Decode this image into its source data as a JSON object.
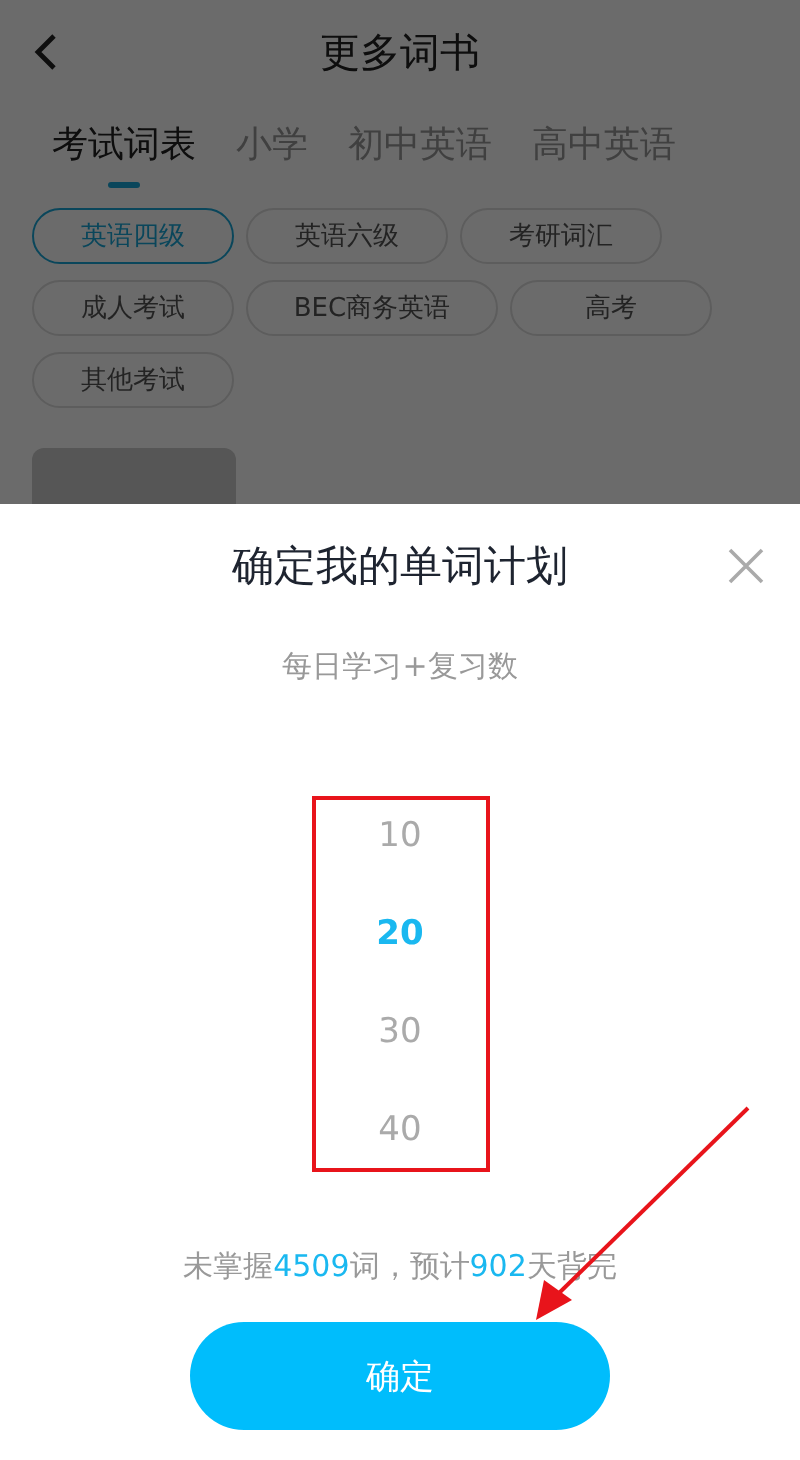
{
  "header": {
    "title": "更多词书"
  },
  "tabs": [
    {
      "label": "考试词表",
      "selected": true
    },
    {
      "label": "小学",
      "selected": false
    },
    {
      "label": "初中英语",
      "selected": false
    },
    {
      "label": "高中英语",
      "selected": false
    }
  ],
  "chips": [
    {
      "label": "英语四级",
      "selected": true
    },
    {
      "label": "英语六级",
      "selected": false
    },
    {
      "label": "考研词汇",
      "selected": false
    },
    {
      "label": "成人考试",
      "selected": false
    },
    {
      "label": "BEC商务英语",
      "selected": false
    },
    {
      "label": "高考",
      "selected": false
    },
    {
      "label": "其他考试",
      "selected": false
    }
  ],
  "dialog": {
    "title": "确定我的单词计划",
    "subtitle": "每日学习+复习数",
    "options": [
      {
        "label": "10",
        "selected": false
      },
      {
        "label": "20",
        "selected": true
      },
      {
        "label": "30",
        "selected": false
      },
      {
        "label": "40",
        "selected": false
      }
    ],
    "summary": [
      {
        "text": "未掌握",
        "highlight": false
      },
      {
        "text": "4509",
        "highlight": true
      },
      {
        "text": "词，预计",
        "highlight": false
      },
      {
        "text": "902",
        "highlight": true
      },
      {
        "text": "天背完",
        "highlight": false
      }
    ],
    "confirm_button": "确定"
  }
}
